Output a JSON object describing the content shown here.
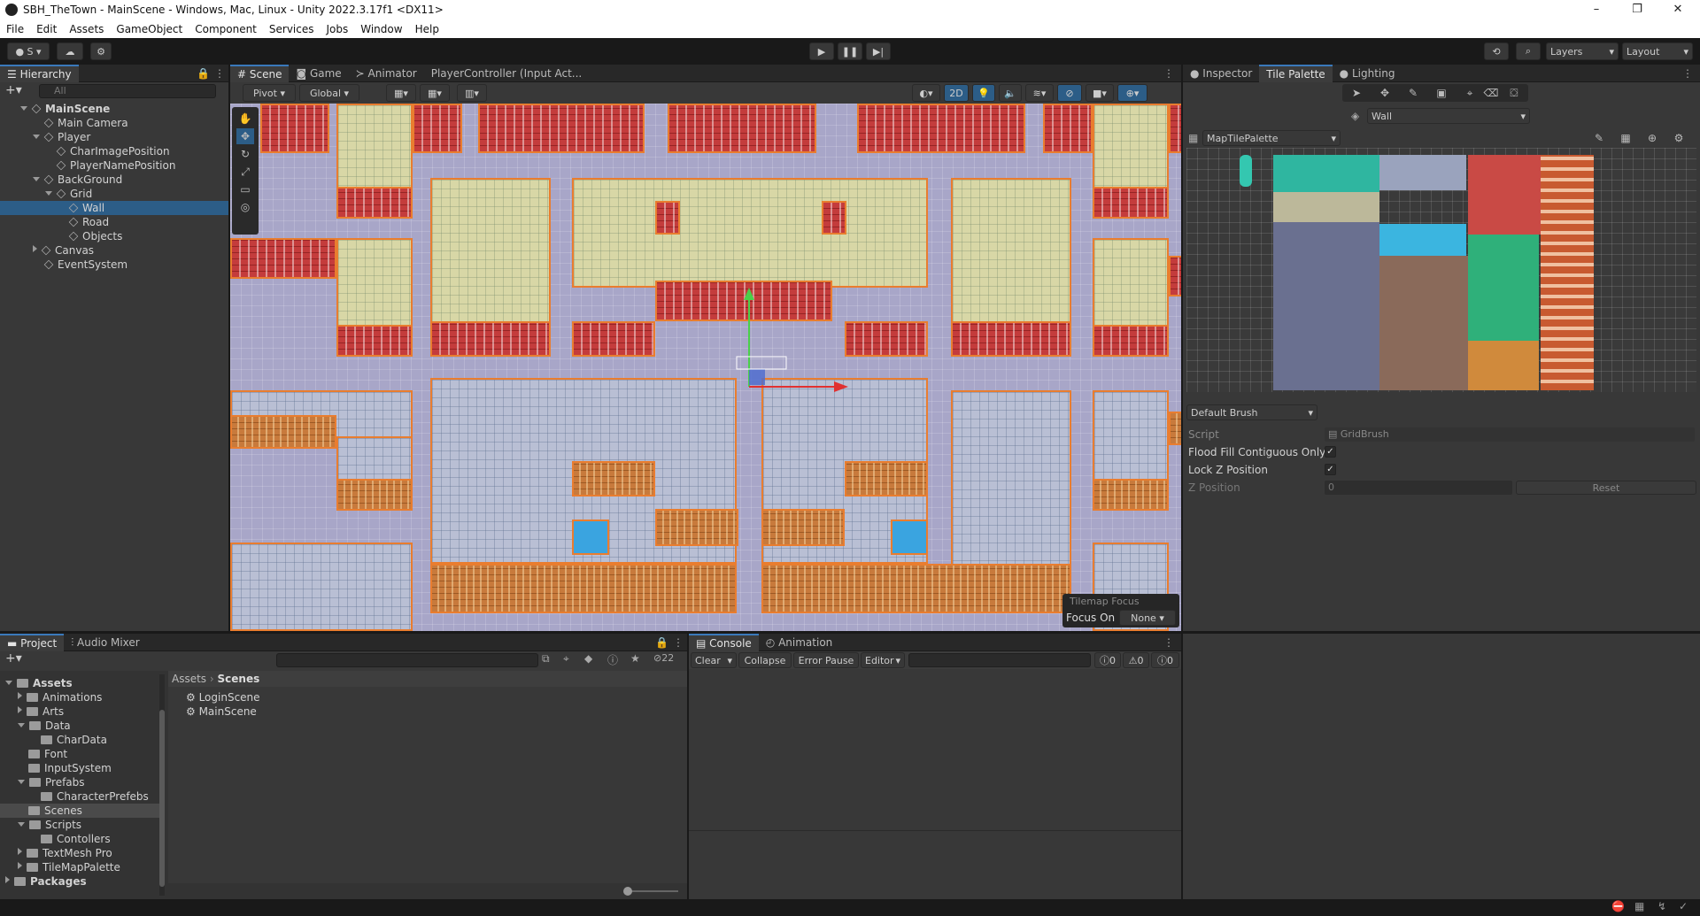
{
  "window": {
    "title": "SBH_TheTown - MainScene - Windows, Mac, Linux - Unity 2022.3.17f1 <DX11>",
    "minimize": "–",
    "maximize": "❐",
    "close": "✕"
  },
  "menu": [
    "File",
    "Edit",
    "Assets",
    "GameObject",
    "Component",
    "Services",
    "Jobs",
    "Window",
    "Help"
  ],
  "toolbar": {
    "account": "S",
    "layers": "Layers",
    "layout": "Layout"
  },
  "hierarchy": {
    "tab": "Hierarchy",
    "search_placeholder": "All",
    "items": [
      {
        "label": "MainScene",
        "indent": 0
      },
      {
        "label": "Main Camera",
        "indent": 1
      },
      {
        "label": "Player",
        "indent": 1
      },
      {
        "label": "CharImagePosition",
        "indent": 2
      },
      {
        "label": "PlayerNamePosition",
        "indent": 2
      },
      {
        "label": "BackGround",
        "indent": 1
      },
      {
        "label": "Grid",
        "indent": 2
      },
      {
        "label": "Wall",
        "indent": 3
      },
      {
        "label": "Road",
        "indent": 3
      },
      {
        "label": "Objects",
        "indent": 3
      },
      {
        "label": "Canvas",
        "indent": 1
      },
      {
        "label": "EventSystem",
        "indent": 1
      }
    ]
  },
  "scene": {
    "tabs": [
      "Scene",
      "Game",
      "Animator",
      "PlayerController (Input Act..."
    ],
    "pivot": "Pivot",
    "global": "Global",
    "mode_2d": "2D",
    "overlay_title": "Tilemap Focus",
    "focus_label": "Focus On",
    "focus_value": "None"
  },
  "inspector": {
    "tabs": [
      "Inspector",
      "Tile Palette",
      "Lighting"
    ],
    "active_tilemap": "Wall",
    "palette": "MapTilePalette",
    "brush": "Default Brush",
    "props": {
      "script_label": "Script",
      "script_value": "GridBrush",
      "flood_label": "Flood Fill Contiguous Only",
      "lockz_label": "Lock Z Position",
      "zpos_label": "Z Position",
      "zpos_value": "0",
      "reset": "Reset"
    }
  },
  "project": {
    "tabs": [
      "Project",
      "Audio Mixer"
    ],
    "hidden_count": "22",
    "breadcrumb": [
      "Assets",
      "Scenes"
    ],
    "tree": [
      {
        "label": "Assets",
        "indent": 0,
        "bold": true
      },
      {
        "label": "Animations",
        "indent": 1
      },
      {
        "label": "Arts",
        "indent": 1
      },
      {
        "label": "Data",
        "indent": 1
      },
      {
        "label": "CharData",
        "indent": 2
      },
      {
        "label": "Font",
        "indent": 1
      },
      {
        "label": "InputSystem",
        "indent": 1
      },
      {
        "label": "Prefabs",
        "indent": 1
      },
      {
        "label": "CharacterPrefebs",
        "indent": 2
      },
      {
        "label": "Scenes",
        "indent": 1
      },
      {
        "label": "Scripts",
        "indent": 1
      },
      {
        "label": "Contollers",
        "indent": 2
      },
      {
        "label": "TextMesh Pro",
        "indent": 1
      },
      {
        "label": "TileMapPalette",
        "indent": 1
      },
      {
        "label": "Packages",
        "indent": 0,
        "bold": true
      }
    ],
    "files": [
      "LoginScene",
      "MainScene"
    ]
  },
  "console": {
    "tabs": [
      "Console",
      "Animation"
    ],
    "clear": "Clear",
    "collapse": "Collapse",
    "error_pause": "Error Pause",
    "editor": "Editor",
    "log_count": "0",
    "warn_count": "0",
    "error_count": "0"
  }
}
